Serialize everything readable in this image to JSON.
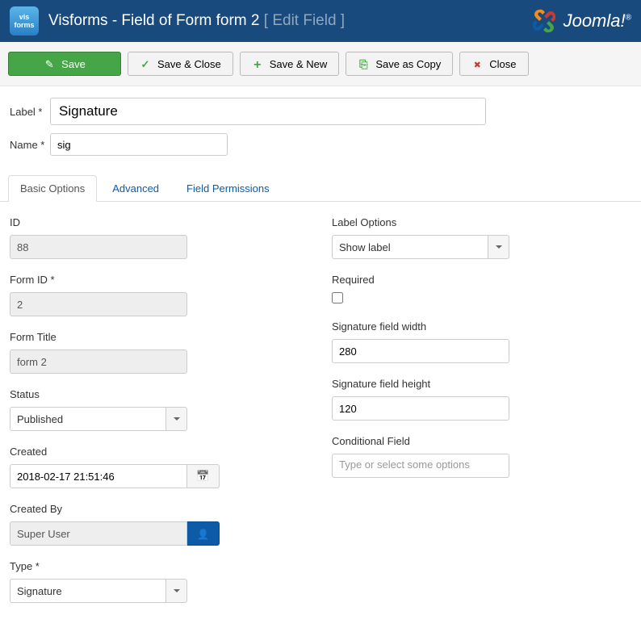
{
  "header": {
    "app_icon_top": "vis",
    "app_icon_bottom": "forms",
    "title_prefix": "Visforms - Field of Form form 2",
    "title_suffix": "[ Edit Field ]",
    "joomla_text": "Joomla!",
    "joomla_reg": "®"
  },
  "toolbar": {
    "save": "Save",
    "save_close": "Save & Close",
    "save_new": "Save & New",
    "save_copy": "Save as Copy",
    "close": "Close"
  },
  "form": {
    "label_lbl": "Label *",
    "label_val": "Signature",
    "name_lbl": "Name *",
    "name_val": "sig"
  },
  "tabs": {
    "basic": "Basic Options",
    "advanced": "Advanced",
    "permissions": "Field Permissions"
  },
  "left": {
    "id_lbl": "ID",
    "id_val": "88",
    "formid_lbl": "Form ID *",
    "formid_val": "2",
    "formtitle_lbl": "Form Title",
    "formtitle_val": "form 2",
    "status_lbl": "Status",
    "status_val": "Published",
    "created_lbl": "Created",
    "created_val": "2018-02-17 21:51:46",
    "createdby_lbl": "Created By",
    "createdby_val": "Super User",
    "type_lbl": "Type *",
    "type_val": "Signature"
  },
  "right": {
    "labelopt_lbl": "Label Options",
    "labelopt_val": "Show label",
    "required_lbl": "Required",
    "width_lbl": "Signature field width",
    "width_val": "280",
    "height_lbl": "Signature field height",
    "height_val": "120",
    "conditional_lbl": "Conditional Field",
    "conditional_placeholder": "Type or select some options"
  }
}
